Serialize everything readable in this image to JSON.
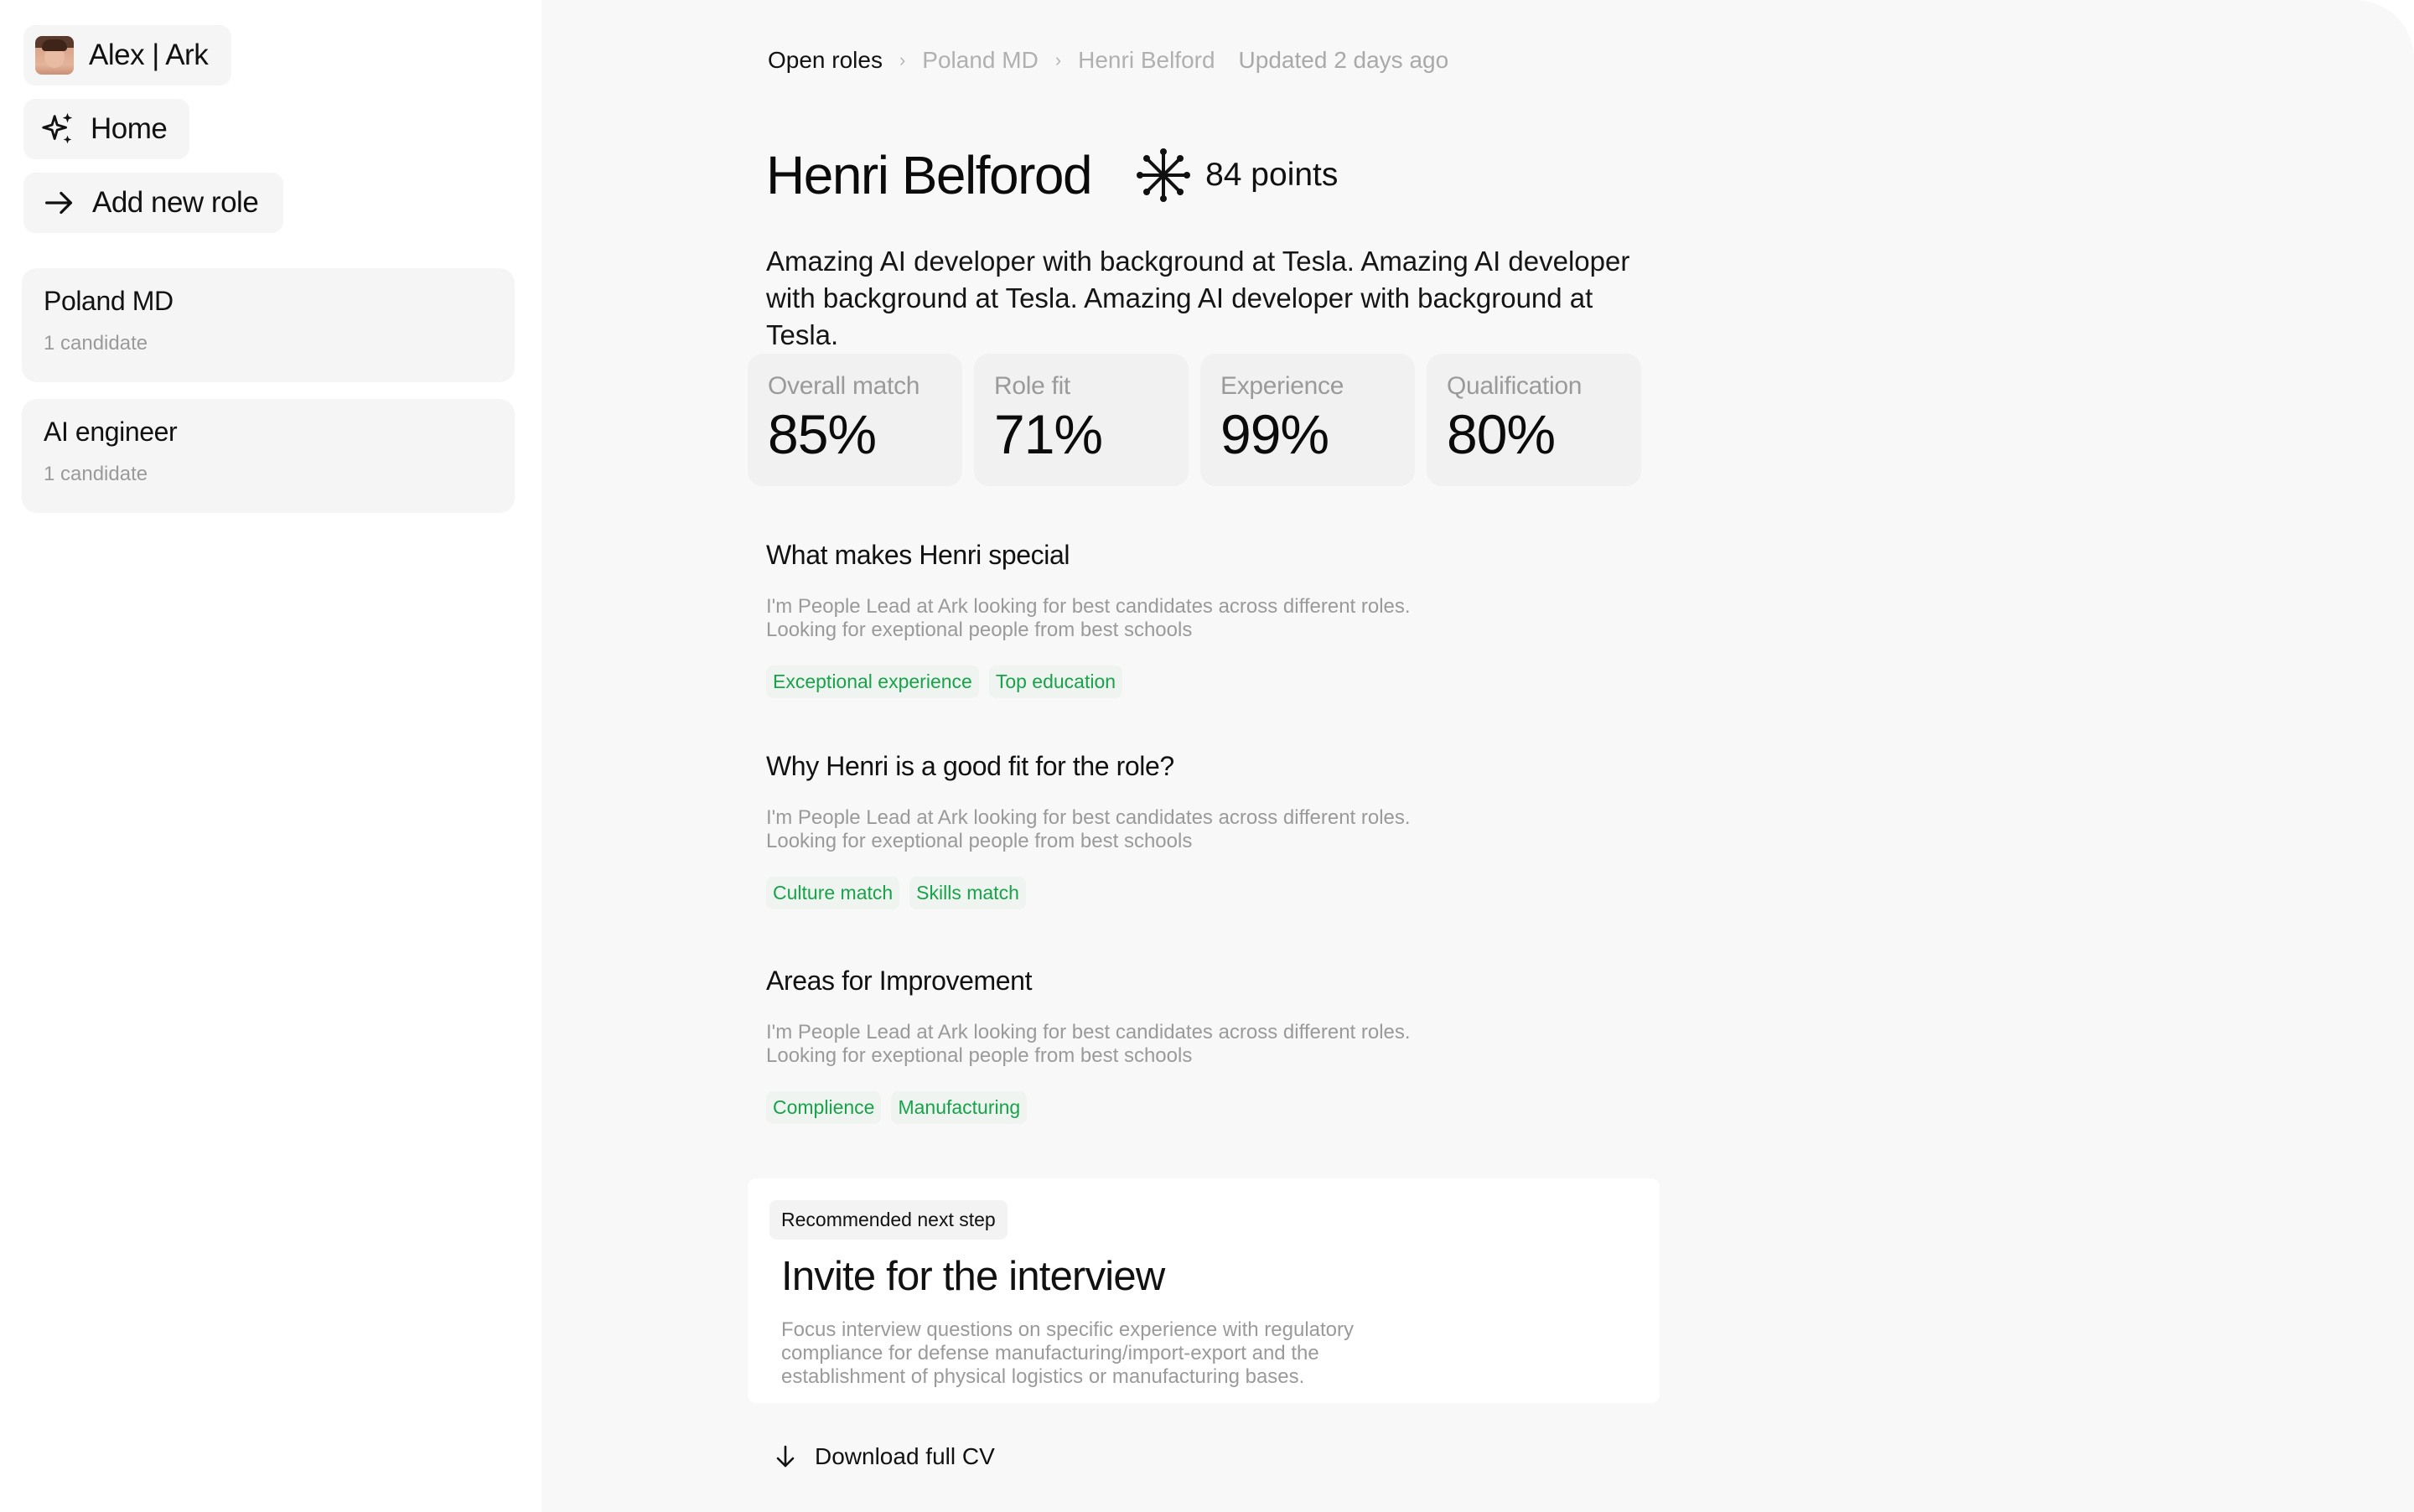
{
  "sidebar": {
    "user_label": "Alex | Ark",
    "home_label": "Home",
    "add_role_label": "Add new role",
    "roles": [
      {
        "title": "Poland MD",
        "subtitle": "1 candidate"
      },
      {
        "title": "AI engineer",
        "subtitle": "1 candidate"
      }
    ]
  },
  "breadcrumb": {
    "items": [
      "Open roles",
      "Poland MD",
      "Henri Belford"
    ],
    "separator": "›",
    "updated": "Updated 2 days ago"
  },
  "candidate": {
    "name": "Henri Belforod",
    "points": "84 points",
    "description": "Amazing AI developer with background at Tesla. Amazing AI developer with background at Tesla. Amazing AI developer with background at Tesla."
  },
  "metrics": [
    {
      "label": "Overall match",
      "value": "85%"
    },
    {
      "label": "Role fit",
      "value": "71%"
    },
    {
      "label": "Experience",
      "value": "99%"
    },
    {
      "label": "Qualification",
      "value": "80%"
    }
  ],
  "sections": [
    {
      "title": "What makes Henri special",
      "line1": "I'm People Lead at Ark looking for best candidates across different roles.",
      "line2": "Looking for exeptional people from best schools",
      "tags": [
        "Exceptional experience",
        "Top education"
      ]
    },
    {
      "title": "Why Henri is a good fit for the role?",
      "line1": "I'm People Lead at Ark looking for best candidates across different roles.",
      "line2": "Looking for exeptional people from best schools",
      "tags": [
        "Culture match",
        "Skills match"
      ]
    },
    {
      "title": "Areas for Improvement",
      "line1": "I'm People Lead at Ark looking for best candidates across different roles.",
      "line2": "Looking for exeptional people from best schools",
      "tags": [
        "Complience",
        "Manufacturing"
      ]
    }
  ],
  "next_step": {
    "badge": "Recommended next step",
    "title": "Invite for the interview",
    "line1": "Focus interview questions on specific experience with regulatory",
    "line2": "compliance for defense manufacturing/import-export and the",
    "line3": "establishment of physical logistics or manufacturing bases."
  },
  "download_label": "Download full CV",
  "colors": {
    "accent_green": "#16a34a",
    "main_bg": "#f8f8f8",
    "card_bg": "#f1f1f1",
    "text_primary": "#0b0b0b",
    "text_muted": "#9a9a9a"
  },
  "icons": {
    "home": "sparkle-icon",
    "add_role": "arrow-right-icon",
    "points": "asterisk-burst-icon",
    "download": "arrow-down-icon"
  }
}
